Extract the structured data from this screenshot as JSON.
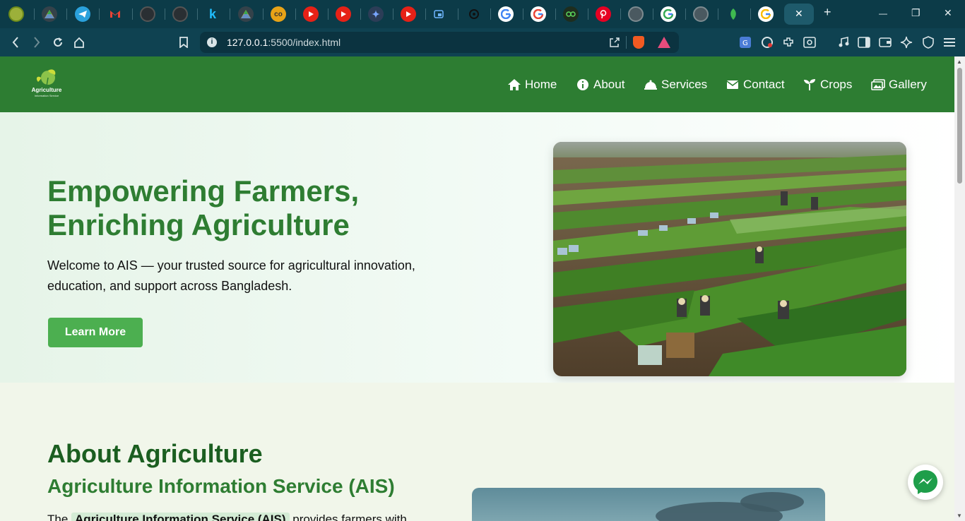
{
  "browser": {
    "url_host": "127.0.0.1",
    "url_path": ":5500/index.html",
    "close_tab_glyph": "✕",
    "new_tab_glyph": "+",
    "minimize_glyph": "—",
    "restore_glyph": "❐",
    "close_window_glyph": "✕",
    "tab_icons": [
      "green-circle",
      "drive",
      "telegram",
      "gmail",
      "github",
      "github",
      "k",
      "drive",
      "co",
      "youtube",
      "youtube",
      "gemini",
      "youtube",
      "media",
      "openai",
      "google",
      "google",
      "chatgpt",
      "pinterest",
      "globe",
      "google",
      "globe",
      "leaf",
      "google"
    ],
    "tab_k_letter": "k",
    "tab_co_letters": "co"
  },
  "site": {
    "logo_title": "Agriculture",
    "logo_subtitle": "Information Service",
    "nav": [
      {
        "label": "Home",
        "icon": "home-icon"
      },
      {
        "label": "About",
        "icon": "info-icon"
      },
      {
        "label": "Services",
        "icon": "bell-icon"
      },
      {
        "label": "Contact",
        "icon": "envelope-icon"
      },
      {
        "label": "Crops",
        "icon": "seedling-icon"
      },
      {
        "label": "Gallery",
        "icon": "images-icon"
      }
    ],
    "colors": {
      "nav_bg": "#2d7d32",
      "accent": "#4caf50",
      "title": "#2e7d32",
      "dark_green": "#1b5e20"
    }
  },
  "hero": {
    "title_line1": "Empowering Farmers,",
    "title_line2": "Enriching Agriculture",
    "text": "Welcome to AIS — your trusted source for agricultural innovation, education, and support across Bangladesh.",
    "button": "Learn More"
  },
  "about": {
    "heading": "About Agriculture",
    "subheading": "Agriculture Information Service (AIS)",
    "text_before": "The",
    "text_highlight": "Agriculture Information Service (AIS)",
    "text_after": "provides farmers with"
  }
}
